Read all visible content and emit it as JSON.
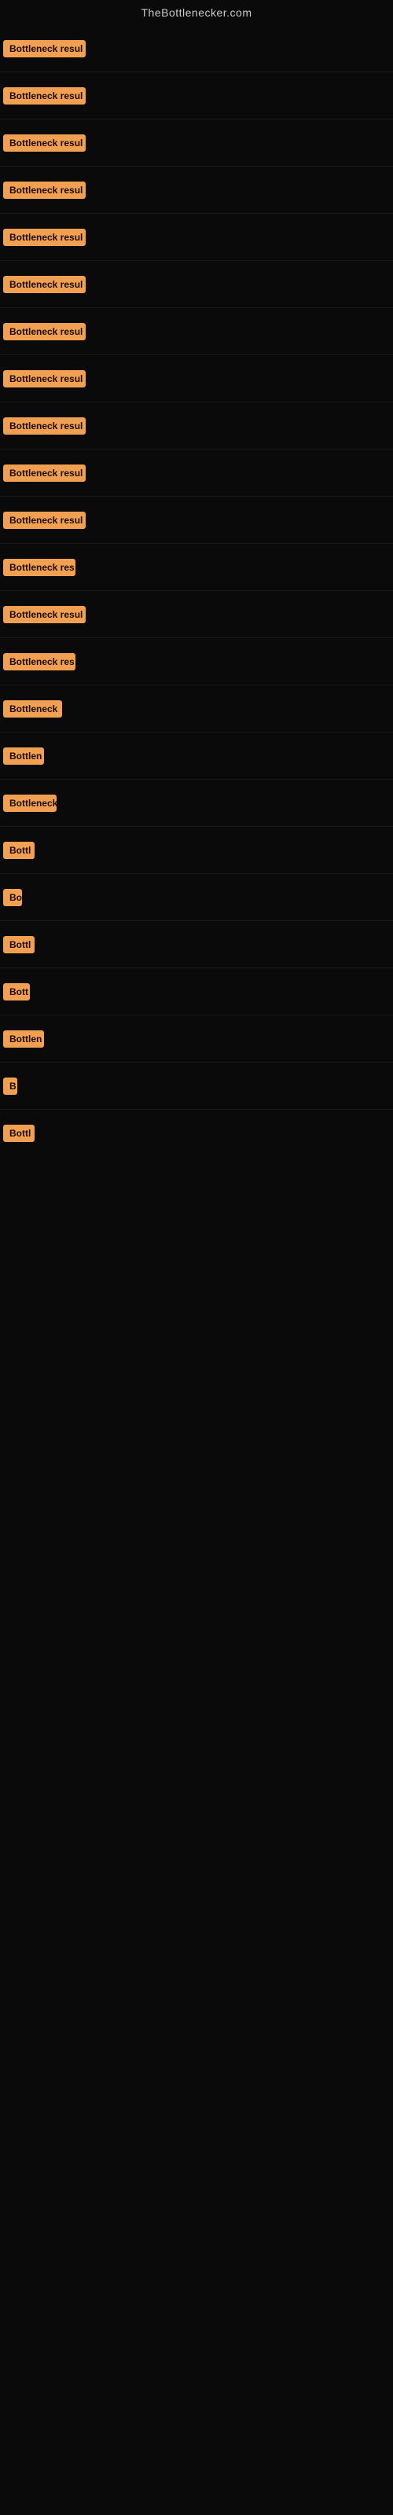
{
  "header": {
    "title": "TheBottlenecker.com"
  },
  "rows": [
    {
      "id": 1,
      "label": "Bottleneck result",
      "visible_chars": 16
    },
    {
      "id": 2,
      "label": "Bottleneck result",
      "visible_chars": 16
    },
    {
      "id": 3,
      "label": "Bottleneck result",
      "visible_chars": 16
    },
    {
      "id": 4,
      "label": "Bottleneck result",
      "visible_chars": 16
    },
    {
      "id": 5,
      "label": "Bottleneck result",
      "visible_chars": 16
    },
    {
      "id": 6,
      "label": "Bottleneck result",
      "visible_chars": 16
    },
    {
      "id": 7,
      "label": "Bottleneck result",
      "visible_chars": 16
    },
    {
      "id": 8,
      "label": "Bottleneck result",
      "visible_chars": 16
    },
    {
      "id": 9,
      "label": "Bottleneck result",
      "visible_chars": 16
    },
    {
      "id": 10,
      "label": "Bottleneck result",
      "visible_chars": 16
    },
    {
      "id": 11,
      "label": "Bottleneck result",
      "visible_chars": 16
    },
    {
      "id": 12,
      "label": "Bottleneck result",
      "visible_chars": 14
    },
    {
      "id": 13,
      "label": "Bottleneck result",
      "visible_chars": 16
    },
    {
      "id": 14,
      "label": "Bottleneck result",
      "visible_chars": 14
    },
    {
      "id": 15,
      "label": "Bottleneck r",
      "visible_chars": 11
    },
    {
      "id": 16,
      "label": "Bottlene",
      "visible_chars": 7
    },
    {
      "id": 17,
      "label": "Bottleneck",
      "visible_chars": 10
    },
    {
      "id": 18,
      "label": "Bottle",
      "visible_chars": 5
    },
    {
      "id": 19,
      "label": "Bo",
      "visible_chars": 2
    },
    {
      "id": 20,
      "label": "Bottle",
      "visible_chars": 5
    },
    {
      "id": 21,
      "label": "Bott",
      "visible_chars": 4
    },
    {
      "id": 22,
      "label": "Bottlene",
      "visible_chars": 7
    },
    {
      "id": 23,
      "label": "B",
      "visible_chars": 1
    },
    {
      "id": 24,
      "label": "Bottle",
      "visible_chars": 5
    }
  ]
}
